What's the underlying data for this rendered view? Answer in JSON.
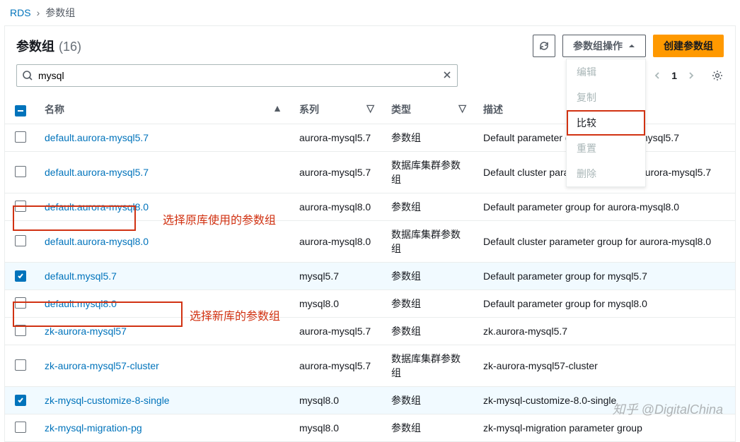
{
  "breadcrumb": {
    "root": "RDS",
    "current": "参数组"
  },
  "header": {
    "title": "参数组",
    "count": "(16)",
    "actions_label": "参数组操作",
    "create_label": "创建参数组"
  },
  "dropdown": {
    "edit": "编辑",
    "copy": "复制",
    "compare": "比较",
    "reset": "重置",
    "delete": "删除"
  },
  "search": {
    "value": "mysql"
  },
  "pager": {
    "page": "1"
  },
  "columns": {
    "name": "名称",
    "family": "系列",
    "type": "类型",
    "description": "描述"
  },
  "rows": [
    {
      "selected": false,
      "name": "default.aurora-mysql5.7",
      "family": "aurora-mysql5.7",
      "type": "参数组",
      "description": "Default parameter group for aurora-mysql5.7"
    },
    {
      "selected": false,
      "name": "default.aurora-mysql5.7",
      "family": "aurora-mysql5.7",
      "type": "数据库集群参数组",
      "description": "Default cluster parameter group for aurora-mysql5.7"
    },
    {
      "selected": false,
      "name": "default.aurora-mysql8.0",
      "family": "aurora-mysql8.0",
      "type": "参数组",
      "description": "Default parameter group for aurora-mysql8.0"
    },
    {
      "selected": false,
      "name": "default.aurora-mysql8.0",
      "family": "aurora-mysql8.0",
      "type": "数据库集群参数组",
      "description": "Default cluster parameter group for aurora-mysql8.0"
    },
    {
      "selected": true,
      "name": "default.mysql5.7",
      "family": "mysql5.7",
      "type": "参数组",
      "description": "Default parameter group for mysql5.7"
    },
    {
      "selected": false,
      "name": "default.mysql8.0",
      "family": "mysql8.0",
      "type": "参数组",
      "description": "Default parameter group for mysql8.0"
    },
    {
      "selected": false,
      "name": "zk-aurora-mysql57",
      "family": "aurora-mysql5.7",
      "type": "参数组",
      "description": "zk.aurora-mysql5.7"
    },
    {
      "selected": false,
      "name": "zk-aurora-mysql57-cluster",
      "family": "aurora-mysql5.7",
      "type": "数据库集群参数组",
      "description": "zk-aurora-mysql57-cluster"
    },
    {
      "selected": true,
      "name": "zk-mysql-customize-8-single",
      "family": "mysql8.0",
      "type": "参数组",
      "description": "zk-mysql-customize-8.0-single"
    },
    {
      "selected": false,
      "name": "zk-mysql-migration-pg",
      "family": "mysql8.0",
      "type": "参数组",
      "description": "zk-mysql-migration parameter group"
    }
  ],
  "annotations": {
    "row5_label": "选择原库使用的参数组",
    "row9_label": "选择新库的参数组"
  },
  "watermark": "知乎 @DigitalChina"
}
